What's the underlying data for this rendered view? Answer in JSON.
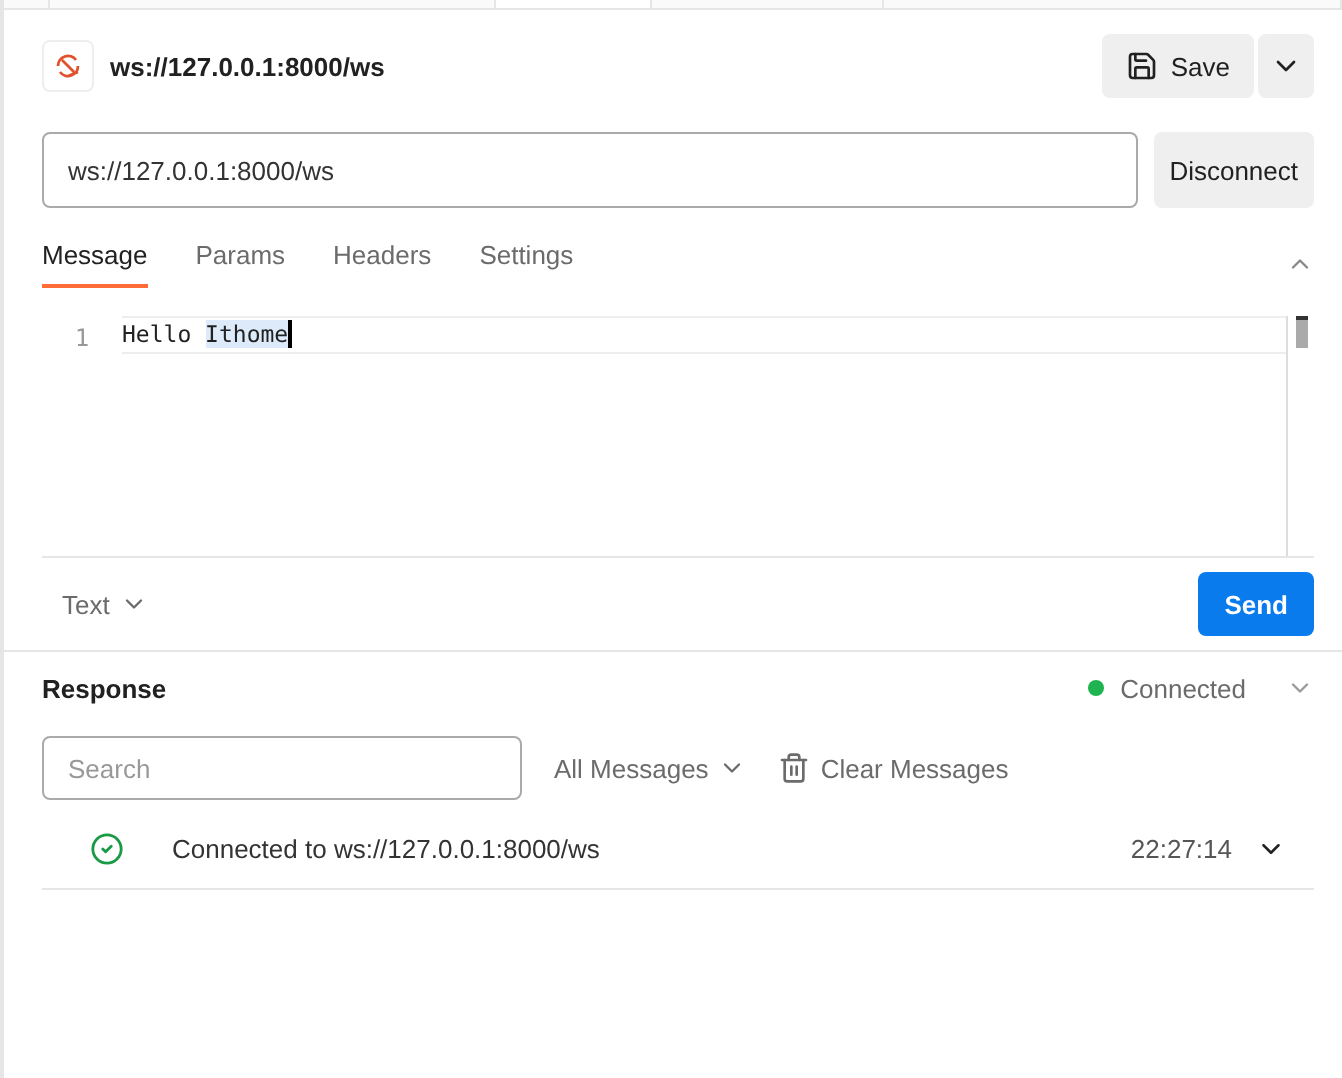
{
  "request": {
    "title": "ws://127.0.0.1:8000/ws",
    "save_label": "Save",
    "url": "ws://127.0.0.1:8000/ws",
    "connect_label": "Disconnect"
  },
  "tabs": [
    {
      "label": "Message",
      "selected": true
    },
    {
      "label": "Params",
      "selected": false
    },
    {
      "label": "Headers",
      "selected": false
    },
    {
      "label": "Settings",
      "selected": false
    }
  ],
  "editor": {
    "line_number": "1",
    "segments": [
      {
        "text": "Hello ",
        "selected": false
      },
      {
        "text": "Ithome",
        "selected": true
      }
    ]
  },
  "message_format": "Text",
  "send_label": "Send",
  "response": {
    "title": "Response",
    "status": {
      "label": "Connected",
      "connected": true
    },
    "search": {
      "placeholder": "Search"
    },
    "filter": "All Messages",
    "clear_label": "Clear Messages",
    "messages": [
      {
        "kind": "connected",
        "text": "Connected to ws://127.0.0.1:8000/ws",
        "time": "22:27:14"
      }
    ]
  }
}
